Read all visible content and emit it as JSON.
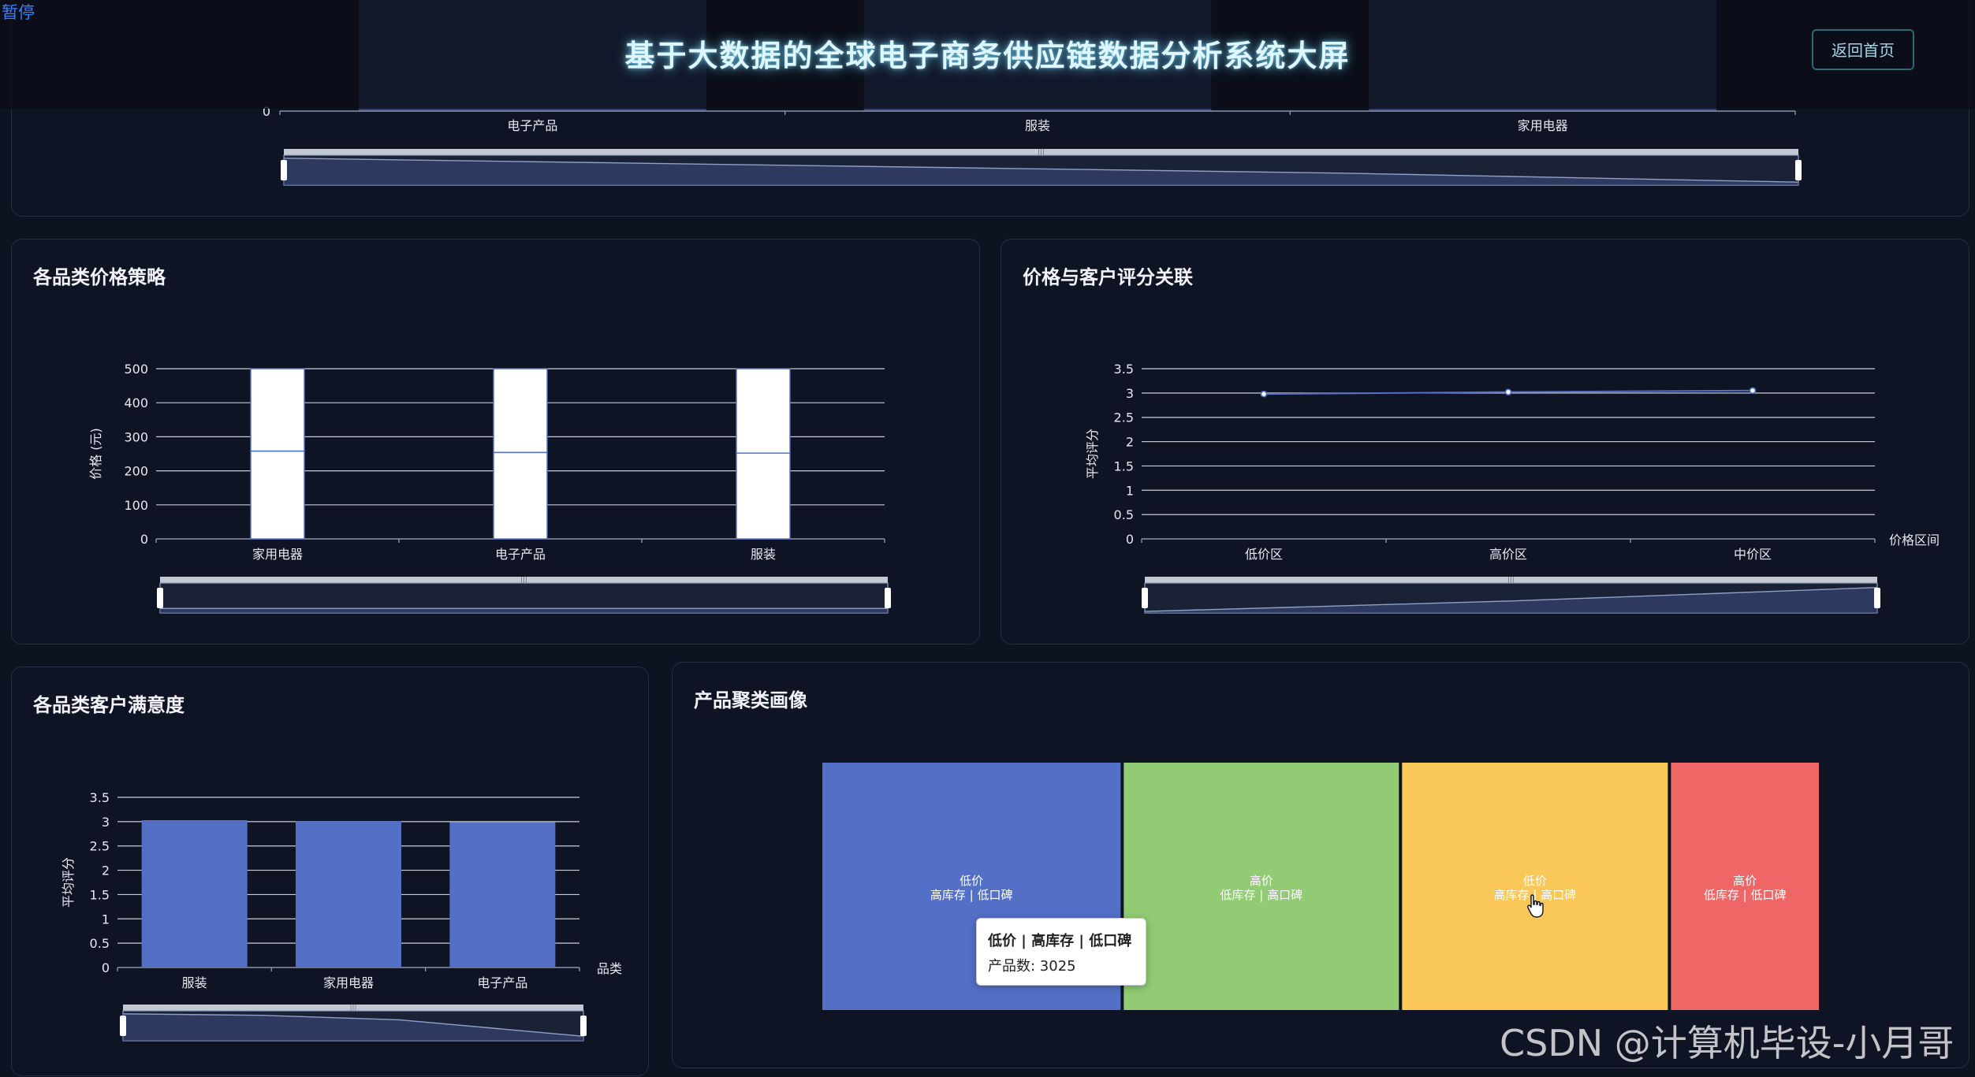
{
  "header": {
    "pause_label": "暂停",
    "title": "基于大数据的全球电子商务供应链数据分析系统大屏",
    "home_button": "返回首页"
  },
  "colors": {
    "background": "#0e1322",
    "accent_blue": "#5470c6",
    "green": "#91cc75",
    "yellow": "#fac858",
    "red": "#ee6666"
  },
  "top_panel": {
    "categories": [
      "电子产品",
      "服装",
      "家用电器"
    ],
    "y_tick_visible": "0"
  },
  "price_panel": {
    "title": "各品类价格策略",
    "chart_data": {
      "type": "bar",
      "subtype": "boxplot",
      "ylabel": "价格 (元)",
      "categories": [
        "家用电器",
        "电子产品",
        "服装"
      ],
      "y_ticks": [
        "0",
        "100",
        "200",
        "300",
        "400",
        "500"
      ],
      "ylim": [
        0,
        500
      ],
      "box": [
        {
          "category": "家用电器",
          "low": 0,
          "median": 258,
          "high": 500
        },
        {
          "category": "电子产品",
          "low": 0,
          "median": 254,
          "high": 500
        },
        {
          "category": "服装",
          "low": 0,
          "median": 252,
          "high": 500
        }
      ]
    }
  },
  "rating_panel": {
    "title": "价格与客户评分关联",
    "chart_data": {
      "type": "line",
      "ylabel": "平均评分",
      "xlabel": "价格区间",
      "categories": [
        "低价区",
        "高价区",
        "中价区"
      ],
      "y_ticks": [
        "0",
        "0.5",
        "1",
        "1.5",
        "2",
        "2.5",
        "3",
        "3.5"
      ],
      "ylim": [
        0,
        3.5
      ],
      "values": [
        2.98,
        3.02,
        3.05
      ]
    }
  },
  "satisfaction_panel": {
    "title": "各品类客户满意度",
    "chart_data": {
      "type": "bar",
      "ylabel": "平均评分",
      "xlabel": "品类",
      "categories": [
        "服装",
        "家用电器",
        "电子产品"
      ],
      "y_ticks": [
        "0",
        "0.5",
        "1",
        "1.5",
        "2",
        "2.5",
        "3",
        "3.5"
      ],
      "ylim": [
        0,
        3.5
      ],
      "values": [
        3.03,
        3.01,
        2.99
      ]
    }
  },
  "cluster_panel": {
    "title": "产品聚类画像",
    "chart_data": {
      "type": "treemap",
      "items": [
        {
          "line1": "低价",
          "line2": "高库存 | 低口碑",
          "value": 3025,
          "color": "#5470c6"
        },
        {
          "line1": "高价",
          "line2": "低库存 | 高口碑",
          "value": 2790,
          "color": "#91cc75"
        },
        {
          "line1": "低价",
          "line2": "高库存 | 高口碑",
          "value": 2695,
          "color": "#fac858"
        },
        {
          "line1": "高价",
          "line2": "低库存 | 低口碑",
          "value": 1500,
          "color": "#ee6666"
        }
      ]
    },
    "tooltip": {
      "title": "低价 | 高库存 | 低口碑",
      "body": "产品数: 3025"
    }
  },
  "watermark": "CSDN @计算机毕设-小月哥"
}
